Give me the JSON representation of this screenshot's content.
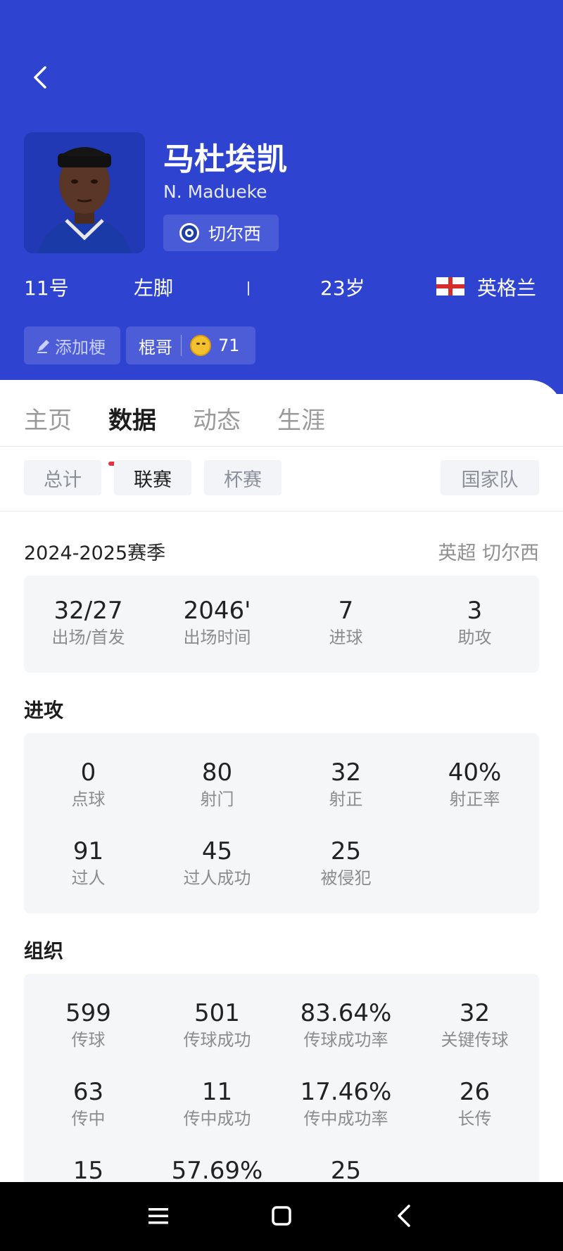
{
  "player": {
    "name_cn": "马杜埃凯",
    "name_en": "N. Madueke",
    "club": "切尔西",
    "number": "11号",
    "foot": "左脚",
    "age": "23岁",
    "country": "英格兰"
  },
  "actions": {
    "add_meme": "添加梗",
    "tag": "棍哥",
    "tag_count": "71"
  },
  "tabs": [
    {
      "label": "主页"
    },
    {
      "label": "数据"
    },
    {
      "label": "动态"
    },
    {
      "label": "生涯"
    }
  ],
  "subtabs": {
    "total": "总计",
    "league": "联赛",
    "cup": "杯赛",
    "national": "国家队"
  },
  "season": {
    "label": "2024-2025赛季",
    "competition": "英超 切尔西"
  },
  "summary": [
    {
      "value": "32/27",
      "label": "出场/首发"
    },
    {
      "value": "2046'",
      "label": "出场时间"
    },
    {
      "value": "7",
      "label": "进球"
    },
    {
      "value": "3",
      "label": "助攻"
    }
  ],
  "attack": {
    "title": "进攻",
    "stats": [
      {
        "value": "0",
        "label": "点球"
      },
      {
        "value": "80",
        "label": "射门"
      },
      {
        "value": "32",
        "label": "射正"
      },
      {
        "value": "40%",
        "label": "射正率"
      },
      {
        "value": "91",
        "label": "过人"
      },
      {
        "value": "45",
        "label": "过人成功"
      },
      {
        "value": "25",
        "label": "被侵犯"
      }
    ]
  },
  "organize": {
    "title": "组织",
    "stats": [
      {
        "value": "599",
        "label": "传球"
      },
      {
        "value": "501",
        "label": "传球成功"
      },
      {
        "value": "83.64%",
        "label": "传球成功率"
      },
      {
        "value": "32",
        "label": "关键传球"
      },
      {
        "value": "63",
        "label": "传中"
      },
      {
        "value": "11",
        "label": "传中成功"
      },
      {
        "value": "17.46%",
        "label": "传中成功率"
      },
      {
        "value": "26",
        "label": "长传"
      },
      {
        "value": "15",
        "label": ""
      },
      {
        "value": "57.69%",
        "label": ""
      },
      {
        "value": "25",
        "label": ""
      }
    ]
  },
  "colors": {
    "header_bg": "#2f43d1",
    "tab_accent": "#e5333b",
    "card_bg": "#f5f6f8"
  }
}
